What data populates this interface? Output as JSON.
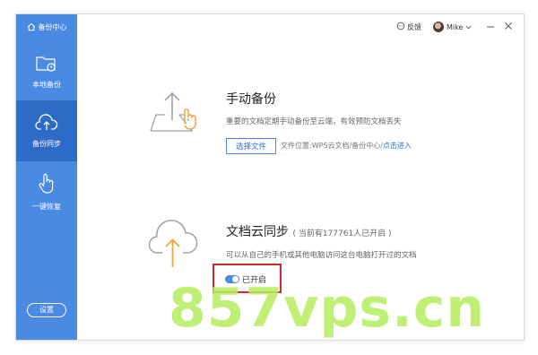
{
  "app": {
    "title": "备份中心"
  },
  "sidebar": {
    "items": [
      {
        "label": "本地备份",
        "icon": "folder-clock-icon"
      },
      {
        "label": "备份同步",
        "icon": "cloud-upload-icon"
      },
      {
        "label": "一键恢复",
        "icon": "hand-pointer-icon"
      }
    ],
    "active_index": 1,
    "settings_label": "设置"
  },
  "topbar": {
    "feedback_label": "反馈",
    "user_name": "Mike",
    "minimize_icon": "minimize-icon",
    "close_icon": "close-icon"
  },
  "manual_backup": {
    "title": "手动备份",
    "description": "重要的文档定期手动备份至云端，有效预防文档丢失",
    "choose_button": "选择文件",
    "location_prefix": "文件位置:WPS云文档/备份中心/",
    "location_link": "点击进入"
  },
  "cloud_sync": {
    "title": "文档云同步",
    "subtitle": "( 当前有177761人已开启 )",
    "description": "可以从自己的手机或其他电脑访问这台电脑打开过的文档",
    "toggle_label": "已开启",
    "toggle_on": true
  },
  "watermark": "857vps.cn",
  "colors": {
    "accent": "#4a8ae3",
    "sidebar_active": "#2d6cc6",
    "highlight_box": "#d9262c",
    "illustration_orange": "#f2a33a"
  }
}
